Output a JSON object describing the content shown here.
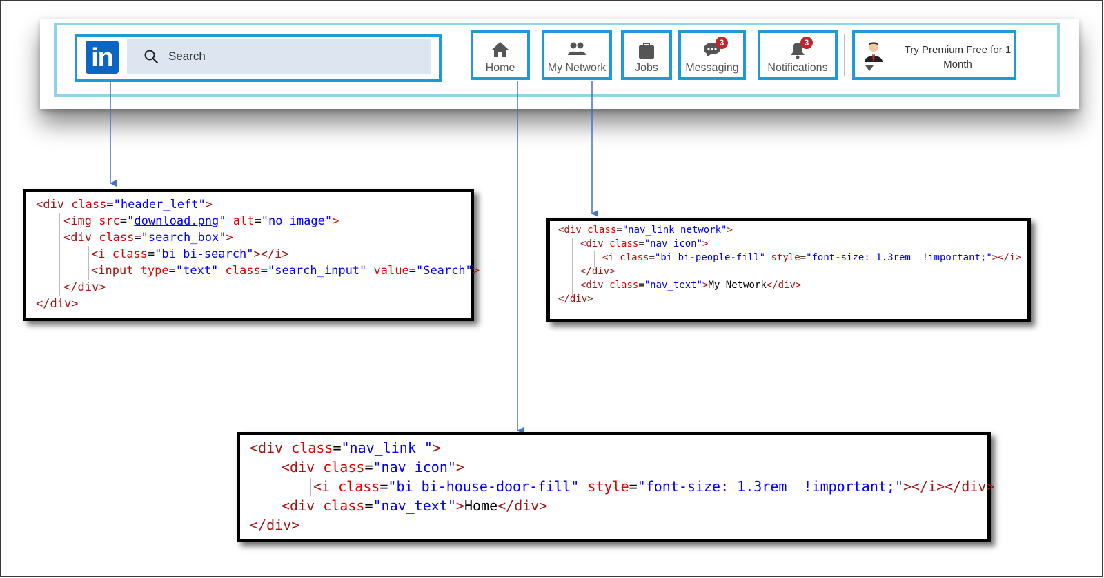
{
  "header": {
    "logo_text": "in",
    "search": {
      "value": "Search",
      "icon": "search-icon"
    },
    "nav": [
      {
        "label": "Home",
        "icon": "home-icon",
        "badge": ""
      },
      {
        "label": "My Network",
        "icon": "people-icon",
        "badge": ""
      },
      {
        "label": "Jobs",
        "icon": "briefcase-icon",
        "badge": ""
      },
      {
        "label": "Messaging",
        "icon": "chat-icon",
        "badge": "3"
      },
      {
        "label": "Notifications",
        "icon": "bell-icon",
        "badge": "3"
      }
    ],
    "premium": {
      "line1": "Try Premium Free for 1",
      "line2": "Month",
      "avatar_icon": "avatar",
      "caret_icon": "caret-down-icon"
    }
  },
  "colors": {
    "highlight": "#1e9bd7",
    "header_border": "#8fd3ea",
    "linkedin_blue": "#0a66c2",
    "badge_red": "#c0262e",
    "arrow": "#4472c4"
  },
  "code_blocks": [
    {
      "name": "header-left-code",
      "lines": [
        "<div class=\"header_left\">",
        "    <img src=\"download.png\" alt=\"no image\">",
        "    <div class=\"search_box\">",
        "        <i class=\"bi bi-search\"></i>",
        "        <input type=\"text\" class=\"search_input\" value=\"Search\">",
        "    </div>",
        "</div>"
      ]
    },
    {
      "name": "network-code",
      "lines": [
        "<div class=\"nav_link network\">",
        "    <div class=\"nav_icon\">",
        "        <i class=\"bi bi-people-fill\" style=\"font-size: 1.3rem  !important;\"></i>",
        "    </div>",
        "    <div class=\"nav_text\">My Network</div>",
        "</div>"
      ]
    },
    {
      "name": "home-code",
      "lines": [
        "<div class=\"nav_link \">",
        "    <div class=\"nav_icon\">",
        "        <i class=\"bi bi-house-door-fill\" style=\"font-size: 1.3rem  !important;\"></i></div>",
        "    <div class=\"nav_text\">Home</div>",
        "</div>"
      ]
    }
  ]
}
